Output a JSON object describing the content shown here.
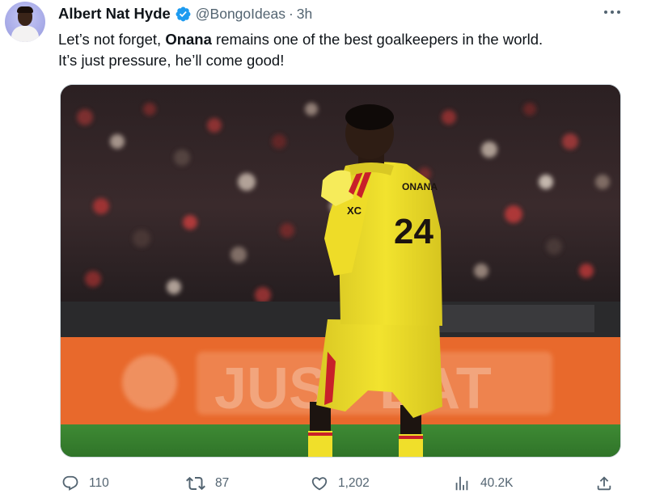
{
  "tweet": {
    "author_name": "Albert Nat Hyde",
    "handle": "@BongoIdeas",
    "separator": "·",
    "time": "3h",
    "text_before": "Let’s not forget, ",
    "text_bold": "Onana",
    "text_line1_after": " remains one of the best goalkeepers in the world.",
    "text_line2": "It’s just pressure, he’ll come good!",
    "media": {
      "jersey_name": "ONANA",
      "jersey_number": "24",
      "sponsor": "XC",
      "board_text": "JUST EAT"
    }
  },
  "actions": {
    "replies": "110",
    "reposts": "87",
    "likes": "1,202",
    "views": "40.2K"
  },
  "colors": {
    "verified": "#1d9bf0",
    "secondary_text": "#536471",
    "kit_yellow": "#f2e32e",
    "board_orange": "#e8692c",
    "pitch_green": "#3e8a34"
  },
  "icons": {
    "verified": "verified-badge-icon",
    "more": "more-icon",
    "reply": "reply-icon",
    "repost": "repost-icon",
    "like": "like-icon",
    "views": "views-icon",
    "share": "share-icon"
  }
}
